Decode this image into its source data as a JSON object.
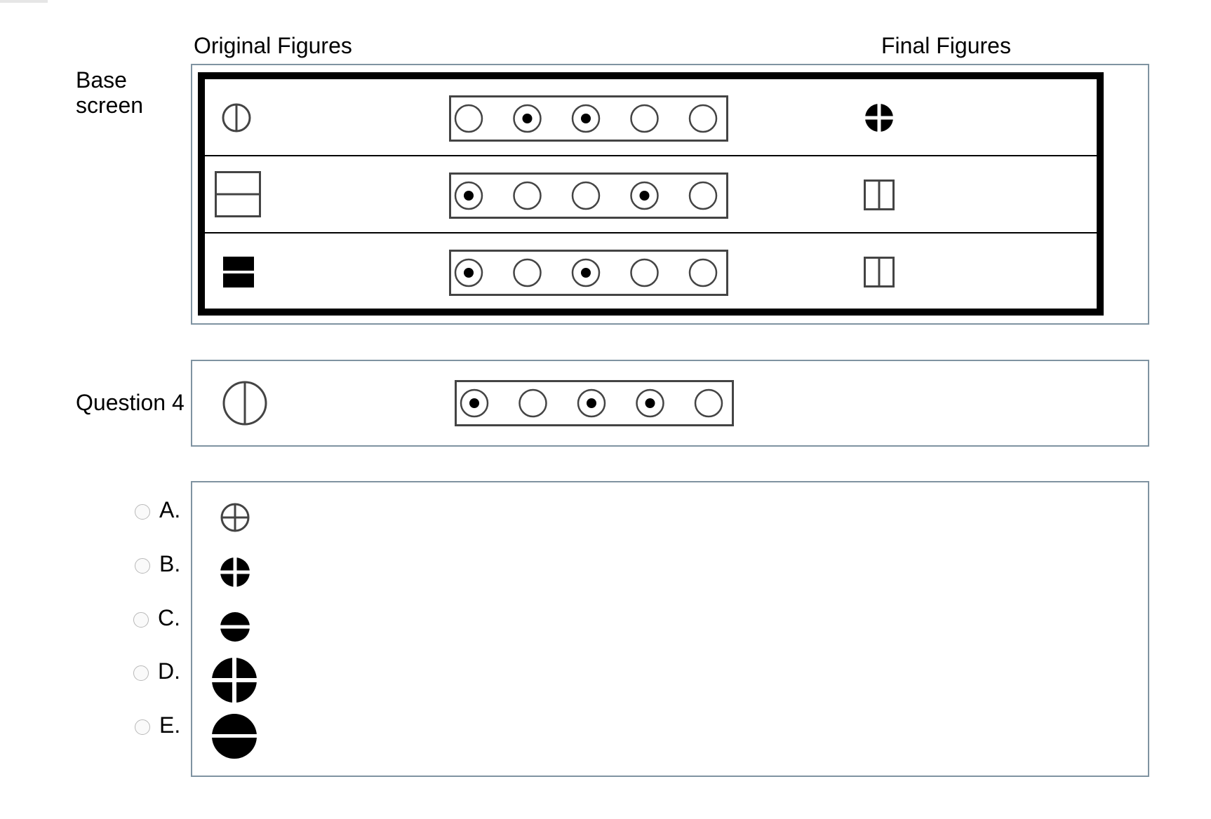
{
  "headers": {
    "original": "Original Figures",
    "final": "Final Figures"
  },
  "labels": {
    "base_line1": "Base",
    "base_line2": "screen",
    "question": "Question 4"
  },
  "icons": {
    "circle_vertical_line": "circle-with-vertical-line-icon",
    "rect_horizontal_line": "rectangle-with-horizontal-line-icon",
    "filled_rect_split": "filled-rectangle-split-horizontally-icon",
    "filled_circle_cross": "filled-circle-with-white-cross-icon",
    "square_vertical_line": "square-with-vertical-line-icon",
    "circle_cross": "circle-with-cross-icon",
    "filled_circle_horizontal": "filled-circle-with-white-horizontal-line-icon"
  },
  "base_rows": [
    {
      "original": "circle-with-vertical-line-icon",
      "dots": [
        false,
        true,
        true,
        false,
        false
      ],
      "final": "filled-circle-with-white-cross-icon"
    },
    {
      "original": "rectangle-with-horizontal-line-icon",
      "dots": [
        true,
        false,
        false,
        true,
        false
      ],
      "final": "square-with-vertical-line-icon"
    },
    {
      "original": "filled-rectangle-split-horizontally-icon",
      "dots": [
        true,
        false,
        true,
        false,
        false
      ],
      "final": "square-with-vertical-line-icon"
    }
  ],
  "question_row": {
    "original": "circle-with-vertical-line-icon",
    "dots": [
      true,
      false,
      true,
      true,
      false
    ]
  },
  "options": [
    {
      "letter": "A.",
      "figure": "circle-with-cross-icon",
      "size": "small"
    },
    {
      "letter": "B.",
      "figure": "filled-circle-with-white-cross-icon",
      "size": "small"
    },
    {
      "letter": "C.",
      "figure": "filled-circle-with-white-horizontal-line-icon",
      "size": "small"
    },
    {
      "letter": "D.",
      "figure": "filled-circle-with-white-cross-icon",
      "size": "large"
    },
    {
      "letter": "E.",
      "figure": "filled-circle-with-white-horizontal-line-icon",
      "size": "large"
    }
  ]
}
